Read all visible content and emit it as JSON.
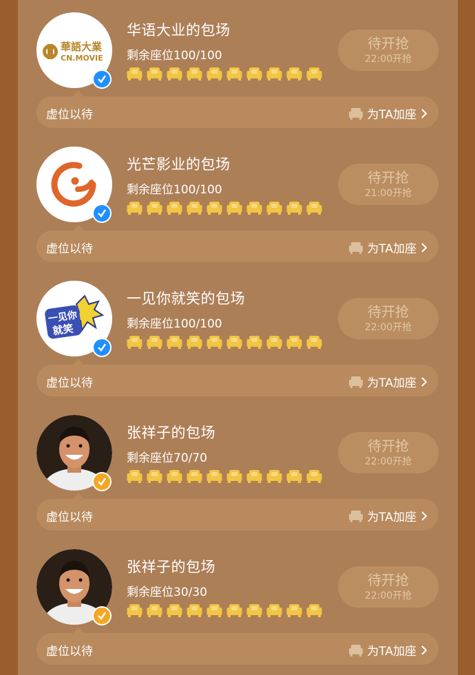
{
  "cards": [
    {
      "avatar": "cn-movie-logo",
      "badge": "verified-blue",
      "title": "华语大业的包场",
      "seats": "剩余座位100/100",
      "button_main": "待开抢",
      "button_sub": "22:00开抢",
      "footer_label": "虚位以待",
      "footer_action": "为TA加座",
      "logo_text_1": "華語大業",
      "logo_text_2": "CN.MOVIE"
    },
    {
      "avatar": "guangmang-logo",
      "badge": "verified-blue",
      "title": "光芒影业的包场",
      "seats": "剩余座位100/100",
      "button_main": "待开抢",
      "button_sub": "21:00开抢",
      "footer_label": "虚位以待",
      "footer_action": "为TA加座"
    },
    {
      "avatar": "yijian-logo",
      "badge": "verified-blue",
      "title": "一见你就笑的包场",
      "seats": "剩余座位100/100",
      "button_main": "待开抢",
      "button_sub": "22:00开抢",
      "footer_label": "虚位以待",
      "footer_action": "为TA加座",
      "logo_text_1": "一见你",
      "logo_text_2": "就笑"
    },
    {
      "avatar": "person-photo",
      "badge": "verified-orange",
      "title": "张祥子的包场",
      "seats": "剩余座位70/70",
      "button_main": "待开抢",
      "button_sub": "22:00开抢",
      "footer_label": "虚位以待",
      "footer_action": "为TA加座"
    },
    {
      "avatar": "person-photo",
      "badge": "verified-orange",
      "title": "张祥子的包场",
      "seats": "剩余座位30/30",
      "button_main": "待开抢",
      "button_sub": "22:00开抢",
      "footer_label": "虚位以待",
      "footer_action": "为TA加座"
    }
  ],
  "colors": {
    "page_bg": "#9a5e2e",
    "panel_bg": "#ad7f57",
    "button_bg": "#bb8e62",
    "button_text": "#e2c8a3",
    "seat_yellow": "#f2c543",
    "badge_blue": "#1e90ff",
    "badge_orange": "#f5a623"
  }
}
